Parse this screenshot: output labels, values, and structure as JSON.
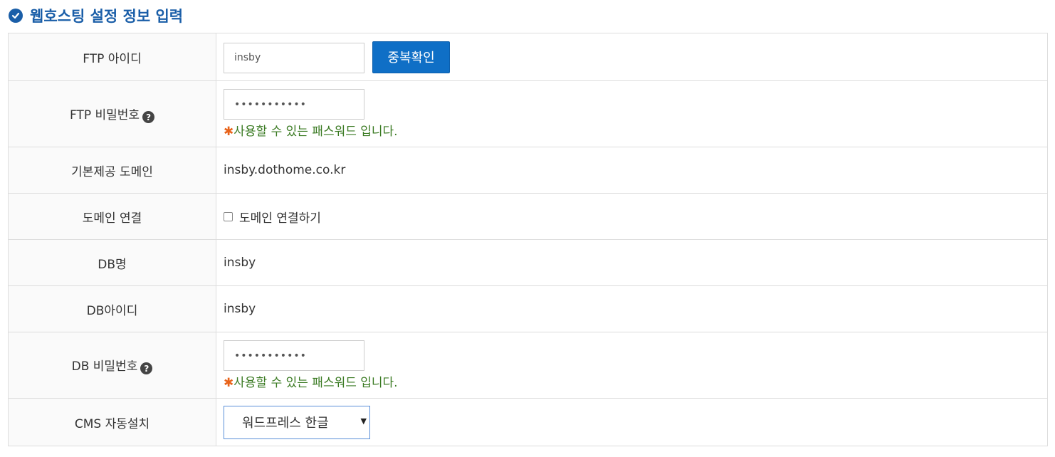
{
  "section": {
    "title": "웹호스팅 설정 정보 입력"
  },
  "rows": {
    "ftp_id": {
      "label": "FTP 아이디",
      "value": "insby",
      "button": "중복확인"
    },
    "ftp_pw": {
      "label": "FTP 비밀번호",
      "value": "•••••••••••",
      "message": "사용할 수 있는 패스워드 입니다."
    },
    "domain": {
      "label": "기본제공 도메인",
      "value": "insby.dothome.co.kr"
    },
    "domain_link": {
      "label": "도메인 연결",
      "checkbox_label": "도메인 연결하기",
      "checked": false
    },
    "db_name": {
      "label": "DB명",
      "value": "insby"
    },
    "db_id": {
      "label": "DB아이디",
      "value": "insby"
    },
    "db_pw": {
      "label": "DB 비밀번호",
      "value": "•••••••••••",
      "message": "사용할 수 있는 패스워드 입니다."
    },
    "cms": {
      "label": "CMS 자동설치",
      "selected": "워드프레스 한글"
    }
  },
  "star_symbol": "✱",
  "help_symbol": "?",
  "colors": {
    "accent": "#1a5ea8",
    "button": "#0f6fc6",
    "success": "#3a7a22",
    "star": "#e8631a"
  },
  "icons": {
    "title": "check-circle-icon",
    "help": "question-circle-icon",
    "select": "caret-down-icon"
  }
}
